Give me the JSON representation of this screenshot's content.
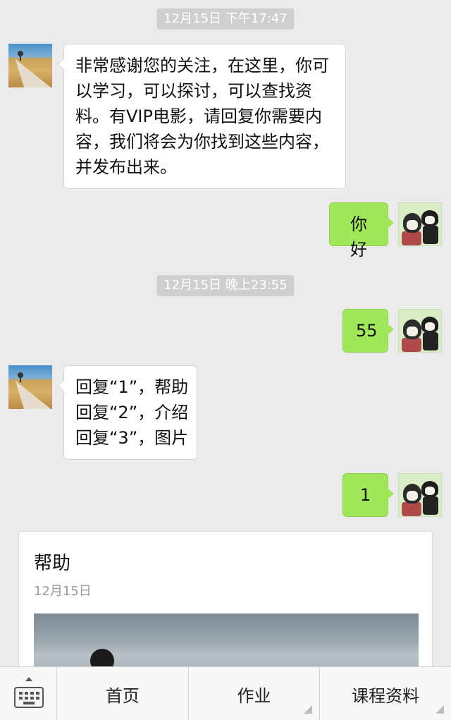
{
  "chat": {
    "timestamps": [
      "12月15日 下午17:47",
      "12月15日 晚上23:55"
    ],
    "messages": [
      {
        "from": "official",
        "lines": [
          "非常感谢您的关注，在这里，你可",
          "以学习，可以探讨，可以查找资",
          "料。有VIP电影，请回复你需要内",
          "容，我们将会为你找到这些内容，",
          "并发布出来。"
        ]
      },
      {
        "from": "user",
        "text": "你好"
      },
      {
        "from": "user",
        "text": "55"
      },
      {
        "from": "official",
        "lines": [
          "回复“1”，帮助",
          "回复“2”，介绍",
          "回复“3”，图片"
        ]
      },
      {
        "from": "user",
        "text": "1"
      }
    ],
    "article_card": {
      "title": "帮助",
      "date": "12月15日"
    }
  },
  "menu": {
    "items": [
      {
        "label": "首页",
        "has_submenu": false
      },
      {
        "label": "作业",
        "has_submenu": true
      },
      {
        "label": "课程资料",
        "has_submenu": true
      }
    ],
    "keyboard_icon": "keyboard-icon"
  },
  "colors": {
    "background": "#ebebeb",
    "outgoing_bubble": "#a0e75a",
    "incoming_bubble": "#ffffff",
    "timestamp_chip": "#cfcfcf"
  }
}
